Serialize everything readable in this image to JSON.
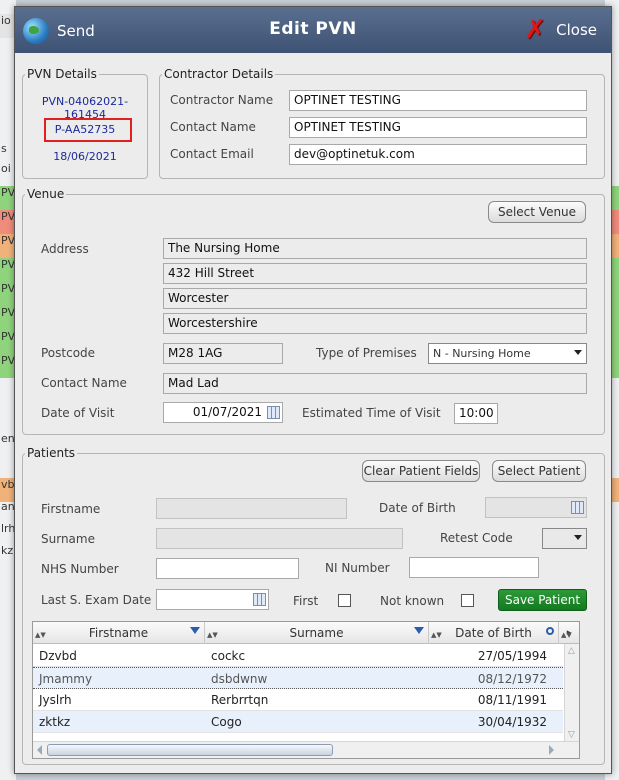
{
  "window": {
    "title": "Edit PVN",
    "send_label": "Send",
    "close_label": "Close"
  },
  "pvn_details": {
    "legend": "PVN Details",
    "pvn_number": "PVN-04062021-161454",
    "patient_ref": "P-AA52735",
    "date": "18/06/2021"
  },
  "contractor": {
    "legend": "Contractor Details",
    "name_label": "Contractor Name",
    "name_value": "OPTINET TESTING",
    "contact_label": "Contact Name",
    "contact_value": "OPTINET TESTING",
    "email_label": "Contact Email",
    "email_value": "dev@optinetuk.com"
  },
  "venue": {
    "legend": "Venue",
    "select_button": "Select Venue",
    "address_label": "Address",
    "address_lines": [
      "The Nursing Home",
      "432 Hill Street",
      "Worcester",
      "Worcestershire"
    ],
    "postcode_label": "Postcode",
    "postcode_value": "M28 1AG",
    "premises_label": "Type of Premises",
    "premises_value": "N - Nursing Home",
    "contact_label": "Contact Name",
    "contact_value": "Mad Lad",
    "visit_label": "Date of Visit",
    "visit_value": "01/07/2021",
    "time_label": "Estimated Time of Visit",
    "time_value": "10:00"
  },
  "patients": {
    "legend": "Patients",
    "clear_button": "Clear Patient Fields",
    "select_button": "Select Patient",
    "firstname_label": "Firstname",
    "firstname_value": "",
    "dob_label": "Date of Birth",
    "dob_value": "",
    "surname_label": "Surname",
    "surname_value": "",
    "retest_label": "Retest Code",
    "retest_value": "",
    "nhs_label": "NHS Number",
    "nhs_value": "",
    "ni_label": "NI Number",
    "ni_value": "",
    "exam_label": "Last S. Exam Date",
    "exam_value": "",
    "first_label": "First",
    "first_checked": false,
    "not_known_label": "Not known",
    "not_known_checked": false,
    "save_button": "Save Patient",
    "grid": {
      "columns": [
        "Firstname",
        "Surname",
        "Date of Birth"
      ],
      "rows": [
        {
          "firstname": "Dzvbd",
          "surname": "cockc",
          "dob": "27/05/1994",
          "struck": false
        },
        {
          "firstname": "Jmammy",
          "surname": "dsbdwnw",
          "dob": "08/12/1972",
          "struck": true
        },
        {
          "firstname": "Jyslrh",
          "surname": "Rerbrrtqn",
          "dob": "08/11/1991",
          "struck": false
        },
        {
          "firstname": "zktkz",
          "surname": "Cogo",
          "dob": "30/04/1932",
          "struck": false
        }
      ]
    }
  },
  "background": {
    "left_cells": [
      "io",
      "s",
      "oi",
      "PV",
      "PV",
      "PV",
      "PV",
      "PV",
      "PV",
      "PV",
      "PV",
      "ent",
      "vb",
      "an",
      "lrh",
      "kz"
    ]
  },
  "colors": {
    "title_bar": "#4a5e80",
    "close_x": "#e01515",
    "save_green": "#1e8a2c",
    "link_blue": "#1b2a9c",
    "highlight_red": "#e02020"
  }
}
